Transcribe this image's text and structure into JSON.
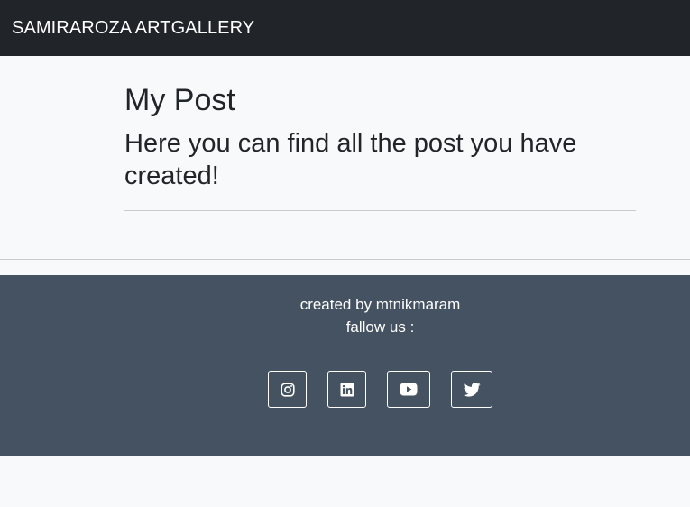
{
  "navbar": {
    "brand": "SAMIRAROZA ARTGALLERY"
  },
  "main": {
    "title": "My Post",
    "subtitle": "Here you can find all the post you have created!"
  },
  "footer": {
    "credit": "created by mtnikmaram",
    "follow_label": "fallow us :",
    "social": [
      {
        "icon": "instagram-icon"
      },
      {
        "icon": "linkedin-icon"
      },
      {
        "icon": "youtube-icon"
      },
      {
        "icon": "twitter-icon"
      }
    ]
  },
  "colors": {
    "navbar_bg": "#212529",
    "page_bg": "#f8f9fa",
    "footer_bg": "#455261",
    "text_dark": "#212529",
    "text_light": "#ffffff"
  }
}
